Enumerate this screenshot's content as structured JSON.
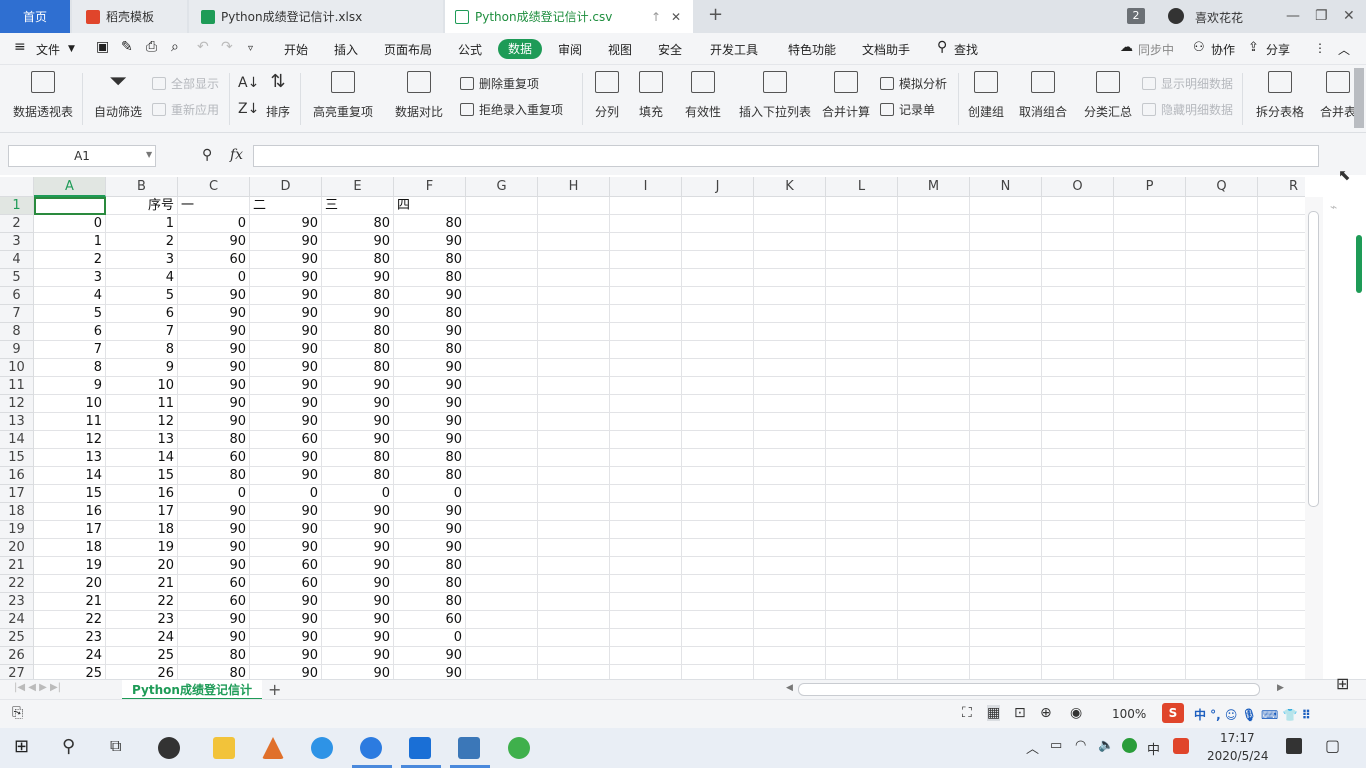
{
  "tabs": {
    "home": "首页",
    "daoke": "稻壳模板",
    "xlsx": "Python成绩登记信计.xlsx",
    "csv": "Python成绩登记信计.csv",
    "badge": "2",
    "user": "喜欢花花"
  },
  "menubar": {
    "file": "文件",
    "items": [
      "开始",
      "插入",
      "页面布局",
      "公式",
      "数据",
      "审阅",
      "视图",
      "安全",
      "开发工具",
      "特色功能",
      "文档助手"
    ],
    "search": "查找",
    "sync": "同步中",
    "collab": "协作",
    "share": "分享"
  },
  "ribbon": {
    "pivot": "数据透视表",
    "autofilter": "自动筛选",
    "show_all": "全部显示",
    "reapply": "重新应用",
    "sort": "排序",
    "highlight_dup": "高亮重复项",
    "compare": "数据对比",
    "remove_dup": "删除重复项",
    "reject_dup": "拒绝录入重复项",
    "split": "分列",
    "fill": "填充",
    "validity": "有效性",
    "insert_dropdown": "插入下拉列表",
    "consolidate": "合并计算",
    "what_if": "模拟分析",
    "record_form": "记录单",
    "group": "创建组",
    "ungroup": "取消组合",
    "subtotal": "分类汇总",
    "show_detail": "显示明细数据",
    "hide_detail": "隐藏明细数据",
    "split_table": "拆分表格",
    "merge_table": "合并表"
  },
  "formula": {
    "namebox": "A1",
    "fx": "fx",
    "value": ""
  },
  "columns": [
    "A",
    "B",
    "C",
    "D",
    "E",
    "F",
    "G",
    "H",
    "I",
    "J",
    "K",
    "L",
    "M",
    "N",
    "O",
    "P",
    "Q",
    "R"
  ],
  "rows": [
    [
      "",
      "序号",
      "一",
      "二",
      "三",
      "四"
    ],
    [
      "0",
      "1",
      "0",
      "90",
      "80",
      "80"
    ],
    [
      "1",
      "2",
      "90",
      "90",
      "90",
      "90"
    ],
    [
      "2",
      "3",
      "60",
      "90",
      "80",
      "80"
    ],
    [
      "3",
      "4",
      "0",
      "90",
      "90",
      "80"
    ],
    [
      "4",
      "5",
      "90",
      "90",
      "80",
      "90"
    ],
    [
      "5",
      "6",
      "90",
      "90",
      "90",
      "80"
    ],
    [
      "6",
      "7",
      "90",
      "90",
      "80",
      "90"
    ],
    [
      "7",
      "8",
      "90",
      "90",
      "80",
      "80"
    ],
    [
      "8",
      "9",
      "90",
      "90",
      "80",
      "90"
    ],
    [
      "9",
      "10",
      "90",
      "90",
      "90",
      "90"
    ],
    [
      "10",
      "11",
      "90",
      "90",
      "90",
      "90"
    ],
    [
      "11",
      "12",
      "90",
      "90",
      "90",
      "90"
    ],
    [
      "12",
      "13",
      "80",
      "60",
      "90",
      "90"
    ],
    [
      "13",
      "14",
      "60",
      "90",
      "80",
      "80"
    ],
    [
      "14",
      "15",
      "80",
      "90",
      "80",
      "80"
    ],
    [
      "15",
      "16",
      "0",
      "0",
      "0",
      "0"
    ],
    [
      "16",
      "17",
      "90",
      "90",
      "90",
      "90"
    ],
    [
      "17",
      "18",
      "90",
      "90",
      "90",
      "90"
    ],
    [
      "18",
      "19",
      "90",
      "90",
      "90",
      "90"
    ],
    [
      "19",
      "20",
      "90",
      "60",
      "90",
      "80"
    ],
    [
      "20",
      "21",
      "60",
      "60",
      "90",
      "80"
    ],
    [
      "21",
      "22",
      "60",
      "90",
      "90",
      "80"
    ],
    [
      "22",
      "23",
      "90",
      "90",
      "90",
      "60"
    ],
    [
      "23",
      "24",
      "90",
      "90",
      "90",
      "0"
    ],
    [
      "24",
      "25",
      "80",
      "90",
      "90",
      "90"
    ],
    [
      "25",
      "26",
      "80",
      "90",
      "90",
      "90"
    ]
  ],
  "sheet": {
    "name": "Python成绩登记信计",
    "add": "+"
  },
  "status": {
    "zoom": "100%"
  },
  "taskbar": {
    "ime": "中",
    "time": "17:17",
    "date": "2020/5/24"
  },
  "colors": {
    "accent": "#1e9b57",
    "home_tab": "#2f6fd1",
    "selection": "#2a8a3e"
  }
}
